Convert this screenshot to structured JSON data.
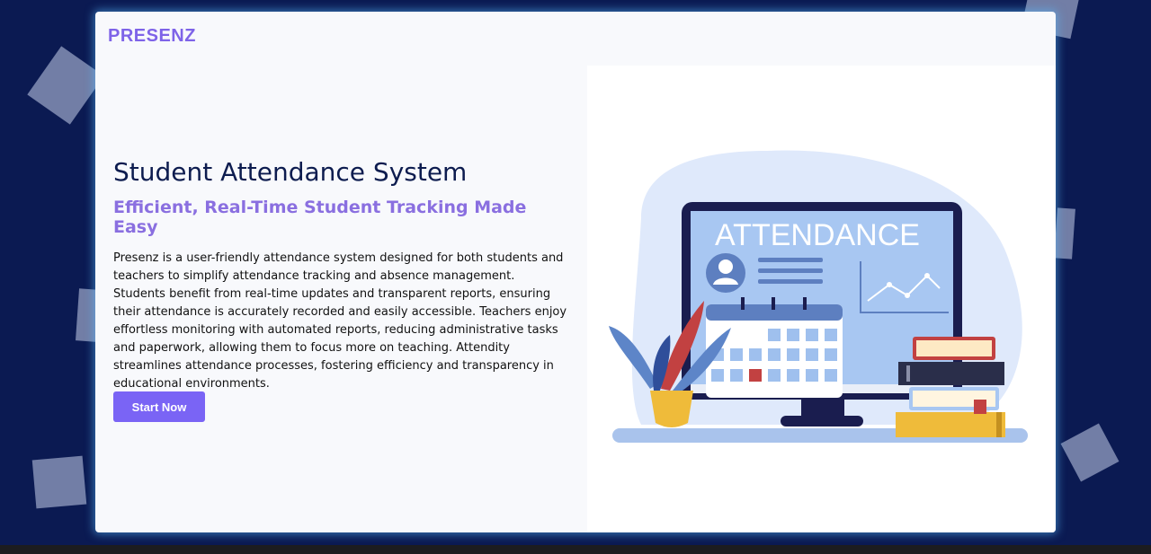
{
  "brand": "PRESENZ",
  "hero": {
    "title": "Student Attendance System",
    "subtitle": "Efficient, Real-Time Student Tracking Made Easy",
    "description": "Presenz is a user-friendly attendance system designed for both students and teachers to simplify attendance tracking and absence management. Students benefit from real-time updates and transparent reports, ensuring their attendance is accurately recorded and easily accessible. Teachers enjoy effortless monitoring with automated reports, reducing administrative tasks and paperwork, allowing them to focus more on teaching. Attendity streamlines attendance processes, fostering efficiency and transparency in educational environments.",
    "cta_label": "Start Now"
  },
  "illustration": {
    "screen_heading": "ATTENDANCE",
    "icons": [
      "monitor-icon",
      "calendar-icon",
      "plant-icon",
      "books-icon",
      "user-icon",
      "line-chart-icon"
    ]
  },
  "colors": {
    "page_bg": "#0b1a52",
    "brand": "#7e63e8",
    "title": "#0d1c4f",
    "subtitle": "#8a6fe0",
    "button": "#7a64f5"
  }
}
